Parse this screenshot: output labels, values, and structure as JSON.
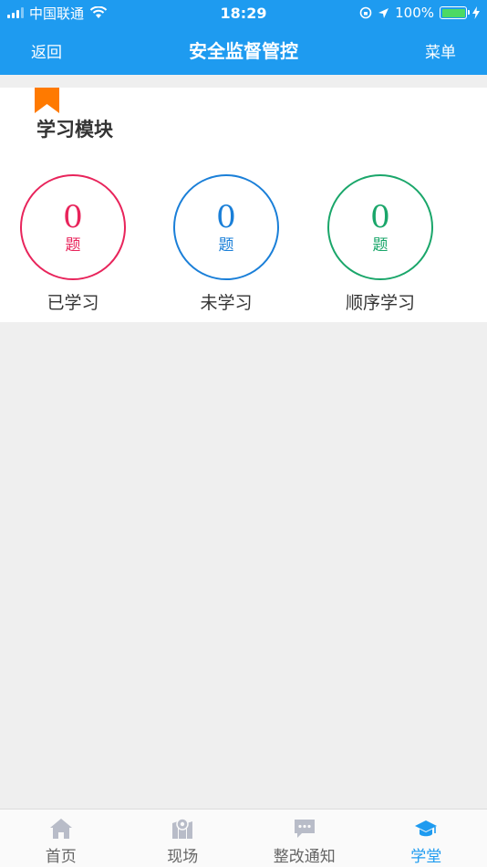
{
  "status_bar": {
    "carrier": "中国联通",
    "time": "18:29",
    "battery": "100%",
    "battery_level": 1.0
  },
  "nav": {
    "back_label": "返回",
    "title": "安全监督管控",
    "menu_label": "菜单"
  },
  "module": {
    "title": "学习模块",
    "stats": [
      {
        "value": "0",
        "unit": "题",
        "label": "已学习",
        "color": "#e8245b"
      },
      {
        "value": "0",
        "unit": "题",
        "label": "未学习",
        "color": "#1a7fd8"
      },
      {
        "value": "0",
        "unit": "题",
        "label": "顺序学习",
        "color": "#1aa66a"
      }
    ]
  },
  "tabs": [
    {
      "label": "首页",
      "icon": "home-icon",
      "active": false
    },
    {
      "label": "现场",
      "icon": "map-icon",
      "active": false
    },
    {
      "label": "整改通知",
      "icon": "chat-icon",
      "active": false
    },
    {
      "label": "学堂",
      "icon": "graduation-cap-icon",
      "active": true
    }
  ],
  "colors": {
    "accent": "#1e9bf0",
    "bookmark": "#ff7a00",
    "inactive_tab": "#b8bcc8"
  }
}
